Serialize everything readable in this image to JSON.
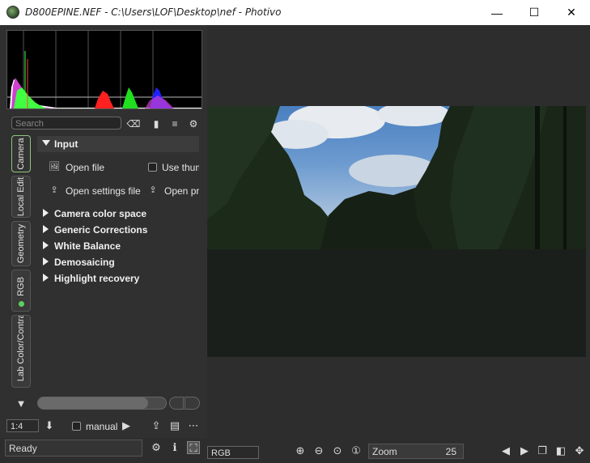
{
  "window": {
    "title": "D800EPINE.NEF - C:\\Users\\LOF\\Desktop\\nef - Photivo",
    "minimize": "—",
    "maximize": "☐",
    "close": "✕"
  },
  "search": {
    "placeholder": "Search"
  },
  "tabs": [
    "Camera",
    "Local Edit",
    "Geometry",
    "RGB",
    "Lab Color/Contrast"
  ],
  "sections": {
    "input": {
      "label": "Input",
      "open_file": "Open file",
      "use_thumbnail": "Use thuml",
      "open_settings_file": "Open settings file",
      "open_preset": "Open pre"
    },
    "collapsed": [
      "Camera color space",
      "Generic Corrections",
      "White Balance",
      "Demosaicing",
      "Highlight recovery"
    ]
  },
  "bottom": {
    "scale": "1:4",
    "manual_label": "manual"
  },
  "status": {
    "ready": "Ready",
    "mode": "RGB",
    "zoom_label": "Zoom",
    "zoom_value": "25"
  }
}
